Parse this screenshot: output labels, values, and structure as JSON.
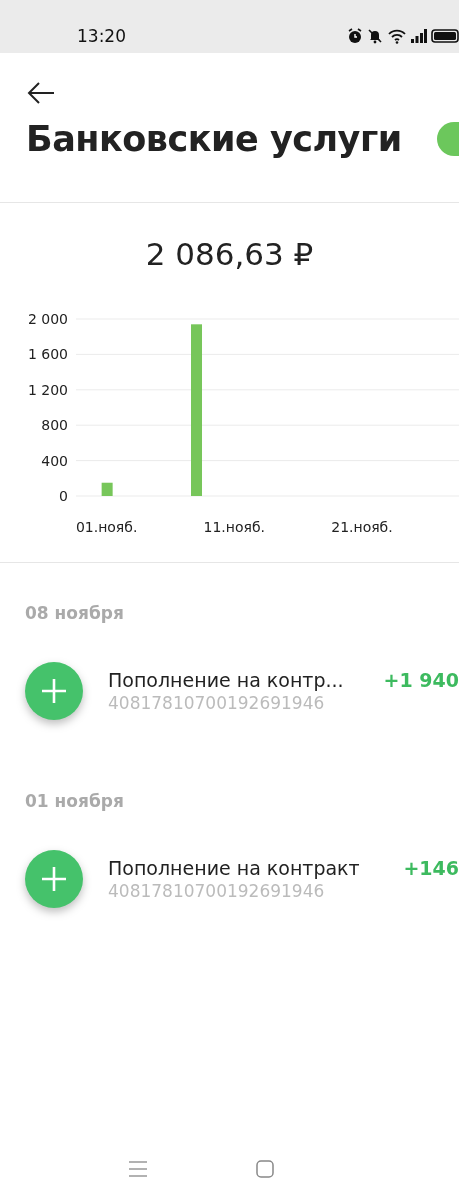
{
  "status_bar": {
    "time": "13:20"
  },
  "header": {
    "title": "Банковские услуги"
  },
  "total": "2 086,63 ₽",
  "chart_data": {
    "type": "bar",
    "x": [
      1,
      8
    ],
    "values": [
      150,
      1940
    ],
    "grid": true,
    "xlim": [
      -1.4,
      28.6
    ],
    "ylim": [
      0,
      2000
    ],
    "xticks": [
      {
        "value": 1,
        "label": "01.нояб."
      },
      {
        "value": 11,
        "label": "11.нояб."
      },
      {
        "value": 21,
        "label": "21.нояб."
      }
    ],
    "yticks": [
      {
        "value": 0,
        "label": "0"
      },
      {
        "value": 400,
        "label": "400"
      },
      {
        "value": 800,
        "label": "800"
      },
      {
        "value": 1200,
        "label": "1 200"
      },
      {
        "value": 1600,
        "label": "1 600"
      },
      {
        "value": 2000,
        "label": "2 000"
      }
    ]
  },
  "groups": [
    {
      "date": "08 ноября",
      "transactions": [
        {
          "title": "Пополнение на контр...",
          "account": "40817810700192691946",
          "amount": "+1 940"
        }
      ]
    },
    {
      "date": "01 ноября",
      "transactions": [
        {
          "title": "Пополнение на контракт",
          "account": "40817810700192691946",
          "amount": "+146"
        }
      ]
    }
  ]
}
